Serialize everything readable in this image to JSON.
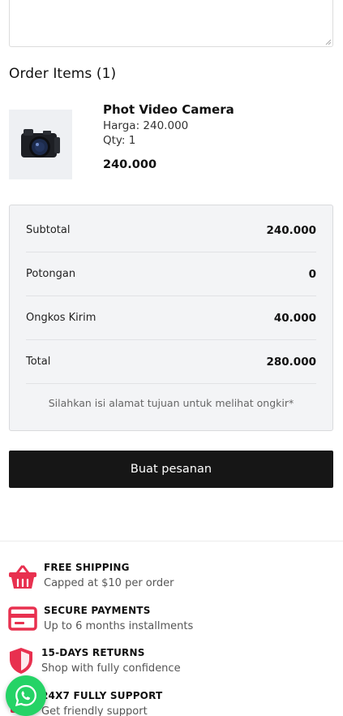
{
  "order_items": {
    "title": "Order Items (1)",
    "items": [
      {
        "name": "Phot Video Camera",
        "price_line": "Harga: 240.000",
        "qty_line": "Qty: 1",
        "total": "240.000",
        "image_icon": "camera-icon"
      }
    ]
  },
  "summary": {
    "rows": [
      {
        "label": "Subtotal",
        "value": "240.000"
      },
      {
        "label": "Potongan",
        "value": "0"
      },
      {
        "label": "Ongkos Kirim",
        "value": "40.000"
      },
      {
        "label": "Total",
        "value": "280.000"
      }
    ],
    "note": "Silahkan isi alamat tujuan untuk melihat ongkir*"
  },
  "actions": {
    "place_order_label": "Buat pesanan"
  },
  "features": [
    {
      "title": "FREE SHIPPING",
      "subtitle": "Capped at $10 per order",
      "icon": "basket-icon"
    },
    {
      "title": "SECURE PAYMENTS",
      "subtitle": "Up to 6 months installments",
      "icon": "credit-card-icon"
    },
    {
      "title": "15-DAYS RETURNS",
      "subtitle": "Shop with fully confidence",
      "icon": "shield-icon"
    },
    {
      "title": "24X7 FULLY SUPPORT",
      "subtitle": "Get friendly support",
      "icon": "headset-icon"
    }
  ],
  "colors": {
    "accent": "#e8304f",
    "button_bg": "#161616",
    "whatsapp": "#25d366",
    "summary_bg": "#f3f4f6"
  },
  "floating": {
    "icon": "whatsapp-icon"
  }
}
